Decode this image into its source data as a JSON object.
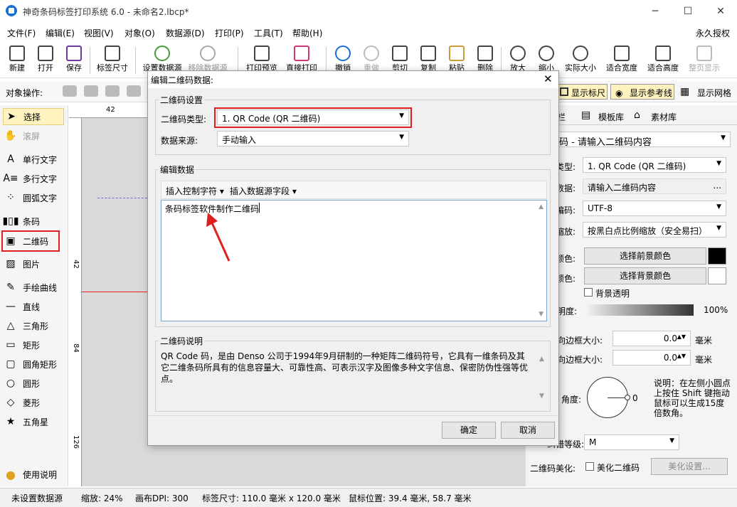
{
  "window": {
    "title": "神奇条码标签打印系统 6.0 - 未命名2.lbcp*"
  },
  "menu": [
    "文件(F)",
    "编辑(E)",
    "视图(V)",
    "对象(O)",
    "数据源(D)",
    "打印(P)",
    "工具(T)",
    "帮助(H)"
  ],
  "menu_right": "永久授权",
  "toolbar": [
    "新建",
    "打开",
    "保存",
    "标签尺寸",
    "设置数据源",
    "移除数据源",
    "打印预览",
    "直接打印",
    "撤销",
    "重做",
    "剪切",
    "复制",
    "粘贴",
    "删除",
    "放大",
    "缩小",
    "实际大小",
    "适合宽度",
    "适合高度",
    "整页显示"
  ],
  "objbar": {
    "label": "对象操作:",
    "show_ruler": "显示标尺",
    "show_guides": "显示参考线",
    "show_grid": "显示网格"
  },
  "left_tools": [
    "选择",
    "滚屏",
    "单行文字",
    "多行文字",
    "圆弧文字",
    "条码",
    "二维码",
    "图片",
    "手绘曲线",
    "直线",
    "三角形",
    "矩形",
    "圆角矩形",
    "圆形",
    "菱形",
    "五角星"
  ],
  "help_label": "使用说明",
  "ruler": {
    "top1": "42",
    "left1": "42",
    "left2": "84",
    "left3": "126"
  },
  "right_panel": {
    "tab_props": "属性栏",
    "tab_templates": "模板库",
    "tab_assets": "素材库",
    "content_select": "码 - 请输入二维码内容",
    "type_label": "类型:",
    "type_value": "1. QR Code (QR 二维码)",
    "data_label": "数据:",
    "data_value": "请输入二维码内容",
    "data_more": "...",
    "encoding_label": "编码:",
    "encoding_value": "UTF-8",
    "scale_label": "缩放:",
    "scale_value": "按黑白点比例缩放（安全易扫）",
    "fg_label": "颜色:",
    "fg_button": "选择前景颜色",
    "bg_label": "颜色:",
    "bg_button": "选择背景颜色",
    "transparent": "背景透明",
    "opacity_label": "明度:",
    "opacity_value": "100%",
    "hborder_label": "向边框大小:",
    "hborder_value": "0.0",
    "vborder_label": "向边框大小:",
    "vborder_value": "0.0",
    "unit": "毫米",
    "angle_label": "角度:",
    "angle_value": "0",
    "angle_note": "说明：在左侧小圆点上按住 Shift 键拖动鼠标可以生成15度倍数角。",
    "ec_label": "纠错等级:",
    "ec_value": "M",
    "beautify_label": "二维码美化:",
    "beautify_check": "美化二维码",
    "beautify_button": "美化设置..."
  },
  "status": {
    "datasource": "未设置数据源",
    "zoom": "缩放: 24%",
    "dpi": "画布DPI: 300",
    "size": "标签尺寸: 110.0 毫米 x 120.0 毫米",
    "mouse": "鼠标位置: 39.4 毫米, 58.7 毫米"
  },
  "dialog": {
    "title": "编辑二维码数据:",
    "group1": "二维码设置",
    "type_label": "二维码类型:",
    "type_value": "1. QR Code (QR 二维码)",
    "source_label": "数据来源:",
    "source_value": "手动输入",
    "group2": "编辑数据",
    "insert_ctrl": "插入控制字符",
    "insert_field": "插入数据源字段",
    "text": "条码标签软件制作二维码",
    "group3": "二维码说明",
    "desc": "QR Code 码，是由 Denso 公司于1994年9月研制的一种矩阵二维码符号，它具有一维条码及其它二维条码所具有的信息容量大、可靠性高、可表示汉字及图像多种文字信息、保密防伪性强等优点。",
    "ok": "确定",
    "cancel": "取消"
  },
  "colors": {
    "accent": "#1a6fd6",
    "highlight_red": "#e02020"
  }
}
